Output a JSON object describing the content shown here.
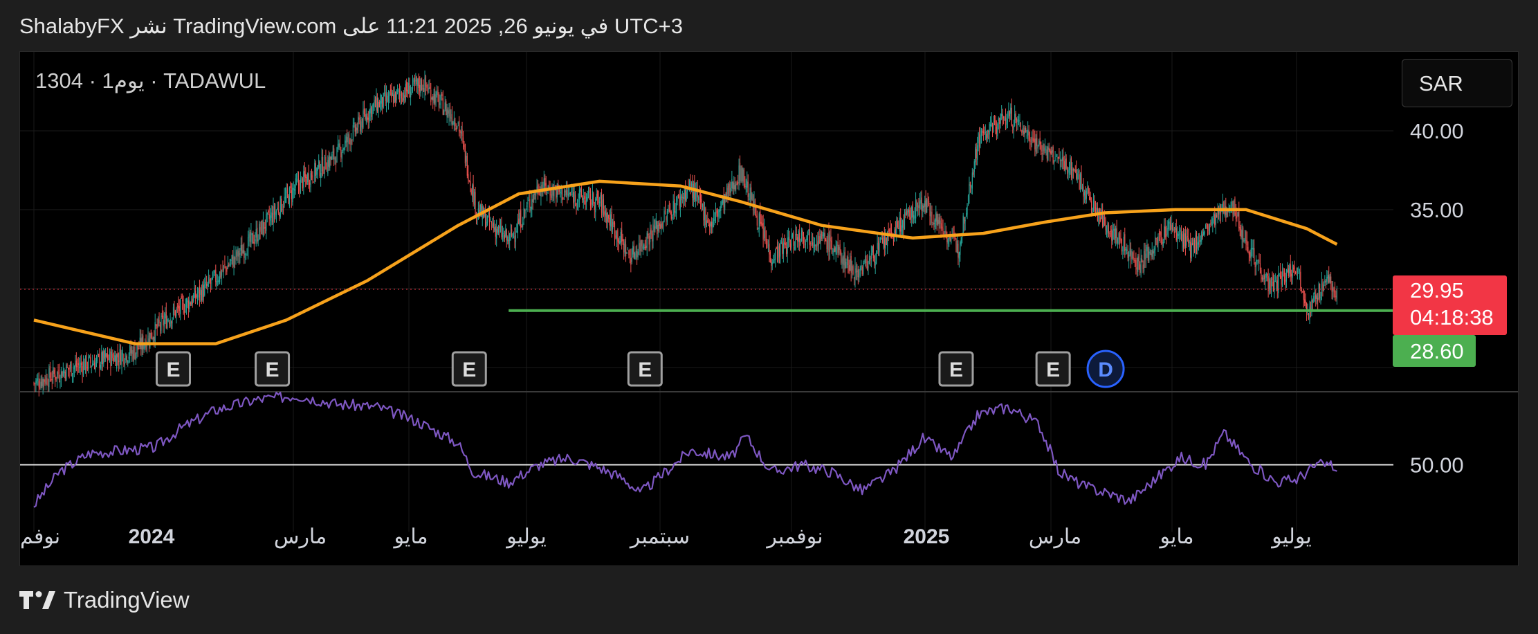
{
  "header": {
    "published_text": "UTC+3 في يونيو 26, 2025 11:21 على TradingView.com نشر ShalabyFX"
  },
  "symbol": {
    "info": "1304 · يوم1 · TADAWUL"
  },
  "currency_button": {
    "label": "SAR"
  },
  "footer": {
    "brand": "TradingView",
    "logo_icon": "tradingview-logo-icon"
  },
  "colors": {
    "background": "#000000",
    "up_candle": "#26a69a",
    "down_candle": "#ef5350",
    "moving_average": "#f7a21b",
    "support_line": "#4caf50",
    "rsi": "#7e57c2",
    "last_price_tag": "#f23645",
    "support_tag": "#4caf50"
  },
  "chart_data": [
    {
      "type": "candlestick",
      "symbol": "1304",
      "exchange": "TADAWUL",
      "interval": "1D",
      "currency": "SAR",
      "ylim": [
        23.5,
        45.0
      ],
      "y_ticks": [
        "40.00",
        "35.00"
      ],
      "x_ticks": [
        "نوفم",
        "2024",
        "مارس",
        "مايو",
        "يوليو",
        "سبتمبر",
        "نوفمبر",
        "2025",
        "مارس",
        "مايو",
        "يوليو"
      ],
      "x_tick_bold": [
        false,
        true,
        false,
        false,
        false,
        false,
        false,
        true,
        false,
        false,
        false
      ],
      "grid": true,
      "price_path": [
        [
          0,
          24.0
        ],
        [
          38,
          25.0
        ],
        [
          70,
          25.5
        ],
        [
          100,
          26.0
        ],
        [
          130,
          28.0
        ],
        [
          170,
          30.0
        ],
        [
          215,
          33.0
        ],
        [
          260,
          36.5
        ],
        [
          300,
          38.5
        ],
        [
          335,
          41.5
        ],
        [
          385,
          43.0
        ],
        [
          420,
          40.5
        ],
        [
          438,
          35.0
        ],
        [
          470,
          33.0
        ],
        [
          500,
          36.5
        ],
        [
          525,
          36.0
        ],
        [
          560,
          35.5
        ],
        [
          590,
          32.0
        ],
        [
          625,
          34.5
        ],
        [
          650,
          36.5
        ],
        [
          670,
          34.0
        ],
        [
          700,
          37.5
        ],
        [
          730,
          32.0
        ],
        [
          760,
          33.5
        ],
        [
          785,
          33.0
        ],
        [
          815,
          31.0
        ],
        [
          850,
          33.5
        ],
        [
          880,
          35.5
        ],
        [
          915,
          32.5
        ],
        [
          935,
          39.5
        ],
        [
          965,
          41.0
        ],
        [
          1005,
          38.5
        ],
        [
          1030,
          37.5
        ],
        [
          1050,
          35.0
        ],
        [
          1075,
          33.0
        ],
        [
          1095,
          31.5
        ],
        [
          1125,
          34.0
        ],
        [
          1145,
          32.5
        ],
        [
          1165,
          34.0
        ],
        [
          1185,
          35.5
        ],
        [
          1200,
          33.0
        ],
        [
          1225,
          30.0
        ],
        [
          1250,
          31.5
        ],
        [
          1262,
          28.5
        ],
        [
          1278,
          30.5
        ],
        [
          1290,
          29.9
        ]
      ],
      "moving_average": {
        "name": "",
        "points": [
          [
            0,
            28.0
          ],
          [
            100,
            26.5
          ],
          [
            180,
            26.5
          ],
          [
            250,
            28.0
          ],
          [
            330,
            30.5
          ],
          [
            420,
            34.0
          ],
          [
            480,
            36.0
          ],
          [
            560,
            36.8
          ],
          [
            640,
            36.5
          ],
          [
            700,
            35.5
          ],
          [
            780,
            34.0
          ],
          [
            870,
            33.2
          ],
          [
            940,
            33.5
          ],
          [
            1000,
            34.2
          ],
          [
            1060,
            34.8
          ],
          [
            1130,
            35.0
          ],
          [
            1200,
            35.0
          ],
          [
            1260,
            33.8
          ],
          [
            1290,
            32.8
          ]
        ]
      },
      "support_line": {
        "value": 28.6,
        "x_start": 470,
        "x_end": 1398
      },
      "last_price": {
        "value": "29.95",
        "countdown": "04:18:38"
      },
      "support_label": {
        "value": "28.60"
      },
      "event_markers": [
        {
          "x": 138,
          "label": "E"
        },
        {
          "x": 236,
          "label": "E"
        },
        {
          "x": 431,
          "label": "E"
        },
        {
          "x": 605,
          "label": "E"
        },
        {
          "x": 913,
          "label": "E"
        },
        {
          "x": 1009,
          "label": "E"
        },
        {
          "x": 1061,
          "label": "D"
        }
      ]
    },
    {
      "type": "line",
      "name": "",
      "indicator": "RSI",
      "ylim": [
        10,
        100
      ],
      "y_ticks": [
        "50.00"
      ],
      "reference_line": 50,
      "points": [
        [
          0,
          22
        ],
        [
          25,
          45
        ],
        [
          55,
          58
        ],
        [
          90,
          60
        ],
        [
          120,
          62
        ],
        [
          145,
          75
        ],
        [
          180,
          88
        ],
        [
          220,
          95
        ],
        [
          260,
          98
        ],
        [
          300,
          92
        ],
        [
          340,
          90
        ],
        [
          380,
          80
        ],
        [
          420,
          65
        ],
        [
          435,
          45
        ],
        [
          470,
          38
        ],
        [
          500,
          50
        ],
        [
          530,
          55
        ],
        [
          560,
          48
        ],
        [
          585,
          40
        ],
        [
          600,
          30
        ],
        [
          625,
          45
        ],
        [
          650,
          60
        ],
        [
          690,
          55
        ],
        [
          705,
          70
        ],
        [
          730,
          45
        ],
        [
          760,
          50
        ],
        [
          790,
          45
        ],
        [
          820,
          32
        ],
        [
          850,
          45
        ],
        [
          880,
          68
        ],
        [
          910,
          55
        ],
        [
          935,
          85
        ],
        [
          965,
          90
        ],
        [
          995,
          78
        ],
        [
          1015,
          45
        ],
        [
          1040,
          35
        ],
        [
          1065,
          30
        ],
        [
          1085,
          25
        ],
        [
          1110,
          40
        ],
        [
          1135,
          55
        ],
        [
          1160,
          50
        ],
        [
          1178,
          72
        ],
        [
          1205,
          50
        ],
        [
          1230,
          38
        ],
        [
          1250,
          40
        ],
        [
          1270,
          50
        ],
        [
          1285,
          50
        ],
        [
          1290,
          45
        ]
      ]
    }
  ]
}
